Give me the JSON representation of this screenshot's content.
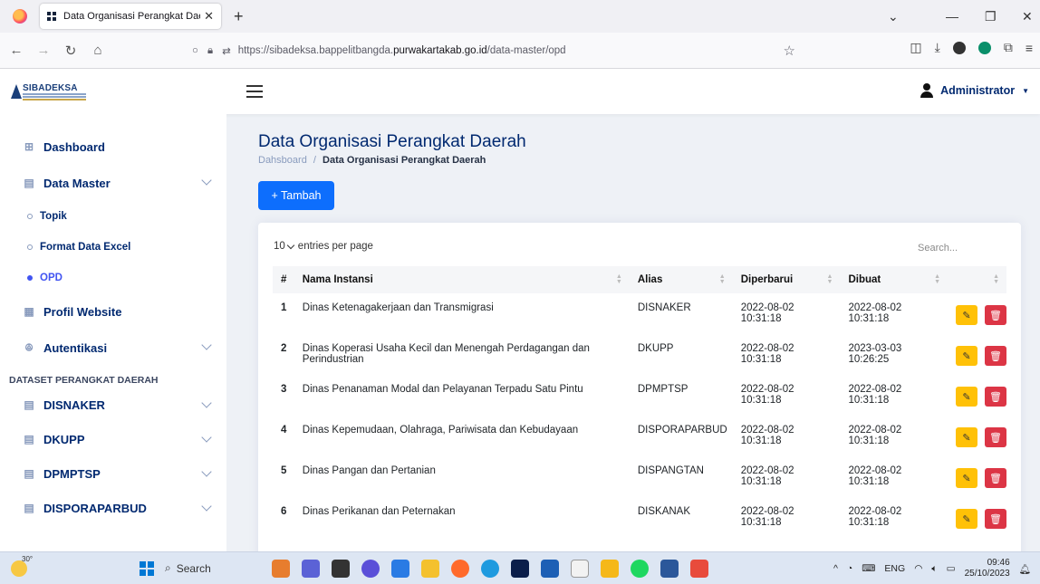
{
  "browser": {
    "tab_title": "Data Organisasi Perangkat Daer",
    "url_prefix": "https://sibadeksa.bappelitbangda.",
    "url_host": "purwakartakab.go.id",
    "url_path": "/data-master/opd"
  },
  "app": {
    "brand": "SIBADEKSA",
    "user": "Administrator"
  },
  "sidebar": {
    "dashboard": "Dashboard",
    "data_master": "Data Master",
    "sub": [
      "Topik",
      "Format Data Excel",
      "OPD"
    ],
    "profil": "Profil Website",
    "autentikasi": "Autentikasi",
    "heading": "DATASET PERANGKAT DAERAH",
    "datasets": [
      "DISNAKER",
      "DKUPP",
      "DPMPTSP",
      "DISPORAPARBUD"
    ]
  },
  "main": {
    "title": "Data Organisasi Perangkat Daerah",
    "crumb_home": "Dahsboard",
    "crumb_sep": "/",
    "crumb_current": "Data Organisasi Perangkat Daerah",
    "add_button": "+ Tambah",
    "per_page_value": "10",
    "per_page_label": "entries per page",
    "search_placeholder": "Search..."
  },
  "table": {
    "headers": [
      "#",
      "Nama Instansi",
      "Alias",
      "Diperbarui",
      "Dibuat"
    ],
    "rows": [
      {
        "no": "1",
        "nama": "Dinas Ketenagakerjaan dan Transmigrasi",
        "alias": "DISNAKER",
        "diperbarui_d": "2022-08-02",
        "diperbarui_t": "10:31:18",
        "dibuat_d": "2022-08-02",
        "dibuat_t": "10:31:18"
      },
      {
        "no": "2",
        "nama": "Dinas Koperasi Usaha Kecil dan Menengah Perdagangan dan Perindustrian",
        "alias": "DKUPP",
        "diperbarui_d": "2022-08-02",
        "diperbarui_t": "10:31:18",
        "dibuat_d": "2023-03-03",
        "dibuat_t": "10:26:25"
      },
      {
        "no": "3",
        "nama": "Dinas Penanaman Modal dan Pelayanan Terpadu Satu Pintu",
        "alias": "DPMPTSP",
        "diperbarui_d": "2022-08-02",
        "diperbarui_t": "10:31:18",
        "dibuat_d": "2022-08-02",
        "dibuat_t": "10:31:18"
      },
      {
        "no": "4",
        "nama": "Dinas Kepemudaan, Olahraga, Pariwisata dan Kebudayaan",
        "alias": "DISPORAPARBUD",
        "diperbarui_d": "2022-08-02",
        "diperbarui_t": "10:31:18",
        "dibuat_d": "2022-08-02",
        "dibuat_t": "10:31:18"
      },
      {
        "no": "5",
        "nama": "Dinas Pangan dan Pertanian",
        "alias": "DISPANGTAN",
        "diperbarui_d": "2022-08-02",
        "diperbarui_t": "10:31:18",
        "dibuat_d": "2022-08-02",
        "dibuat_t": "10:31:18"
      },
      {
        "no": "6",
        "nama": "Dinas Perikanan dan Peternakan",
        "alias": "DISKANAK",
        "diperbarui_d": "2022-08-02",
        "diperbarui_t": "10:31:18",
        "dibuat_d": "2022-08-02",
        "dibuat_t": "10:31:18"
      }
    ]
  },
  "taskbar": {
    "temp": "30°",
    "search": "Search",
    "lang": "ENG",
    "time": "09:46",
    "date": "25/10/2023"
  }
}
